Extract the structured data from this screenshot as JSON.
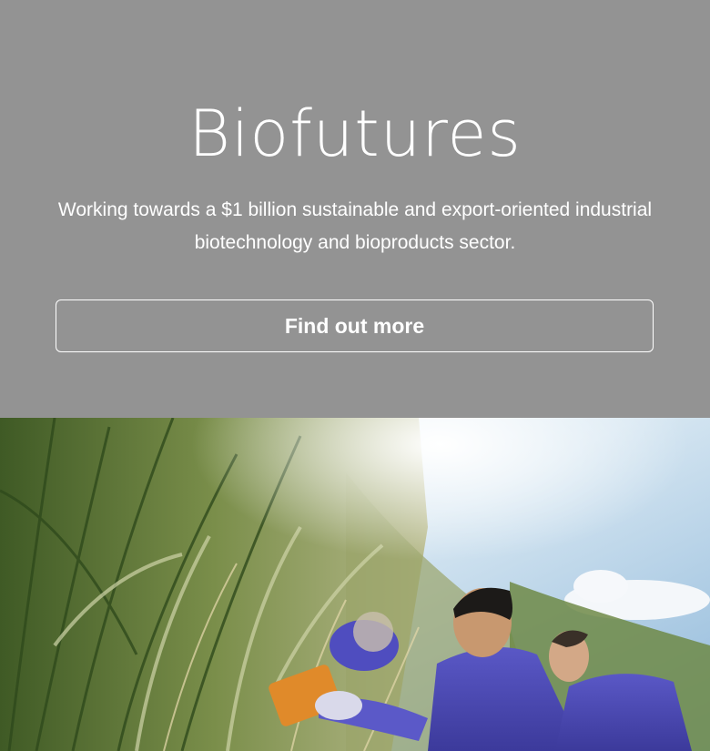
{
  "hero": {
    "title": "Biofutures",
    "subtitle": "Working towards a $1 billion sustainable and export-oriented industrial biotechnology and bioproducts sector.",
    "cta_label": "Find out more"
  },
  "photo": {
    "icon": "sugarcane-field-photo",
    "colors": {
      "sky": "#bcd6ea",
      "grass": "#5f7e3c",
      "shirt": "#4b49b3"
    }
  }
}
